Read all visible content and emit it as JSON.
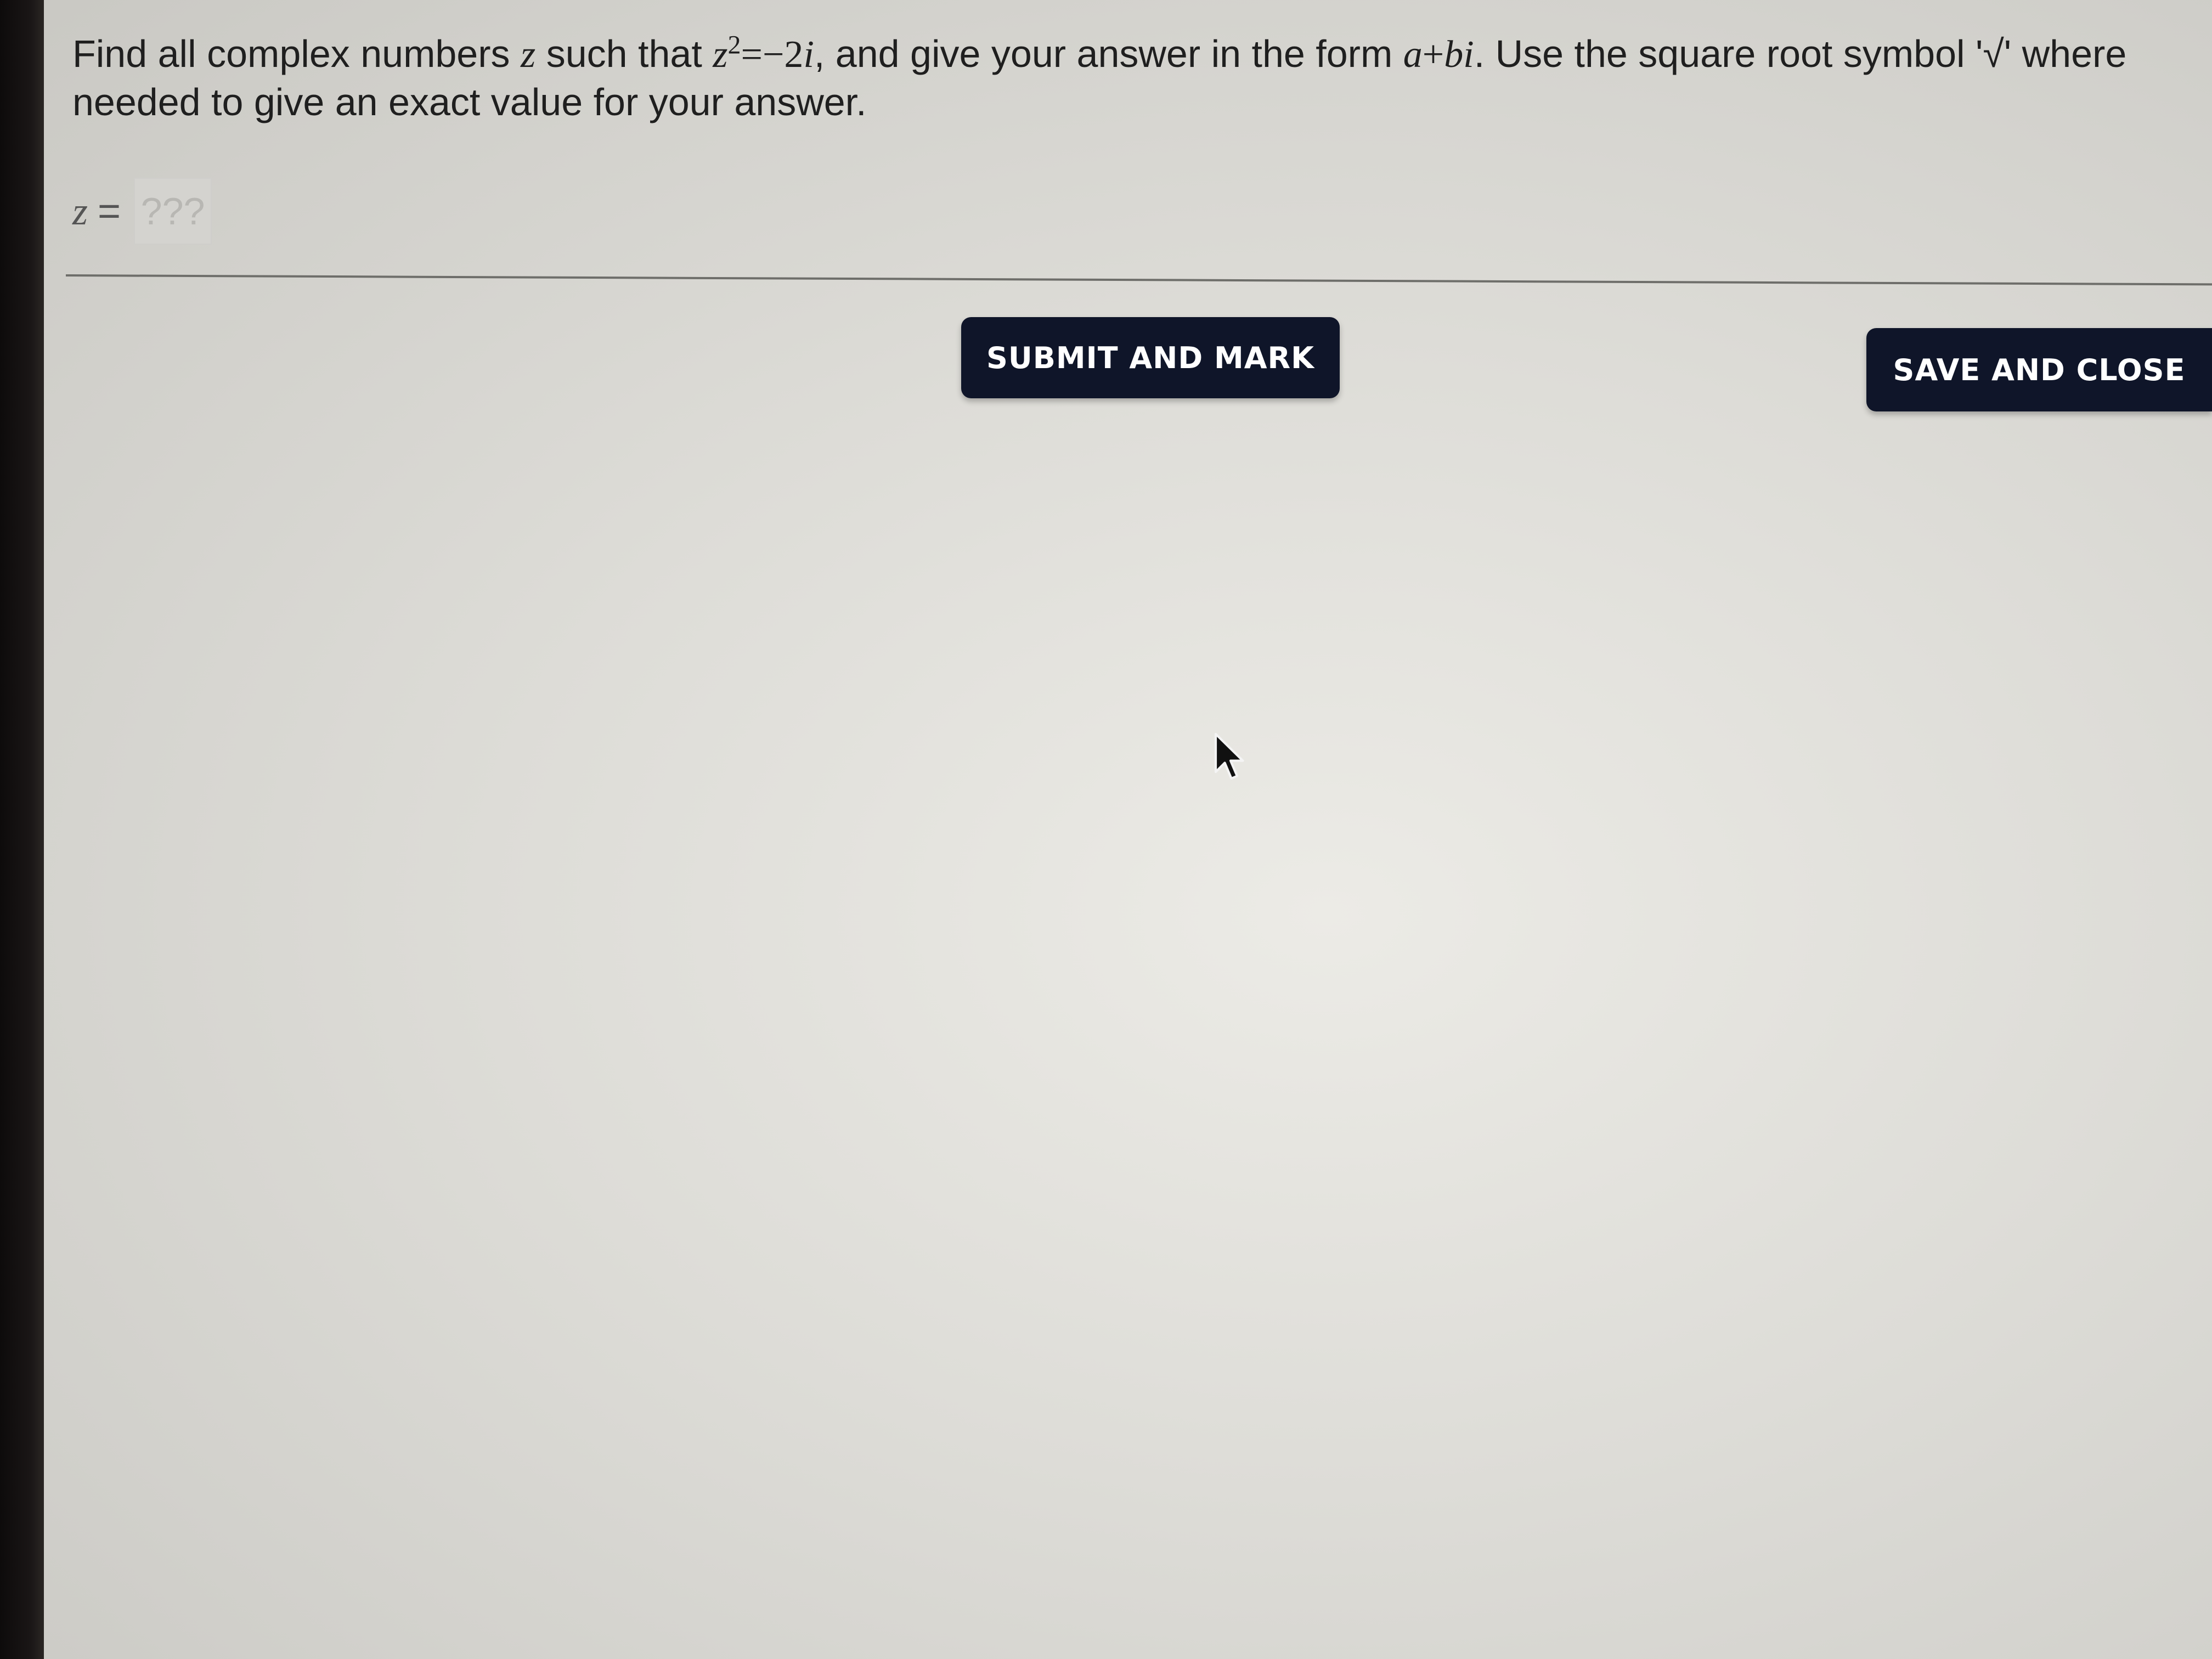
{
  "question": {
    "part1": "Find all complex numbers ",
    "var_z": "z",
    "part2": " such that ",
    "eq_z": "z",
    "eq_exp": "2",
    "eq_rhs": "=−2",
    "eq_i": "i",
    "part3": ", and give your answer in the form ",
    "form_a": "a",
    "form_plus": "+",
    "form_bi": "bi",
    "part4": ". Use the square root symbol '√' where needed to give an exact value for your answer."
  },
  "answer": {
    "label": "z",
    "equals": "=",
    "placeholder": "???"
  },
  "buttons": {
    "submit_label": "SUBMIT AND MARK",
    "save_label": "SAVE AND CLOSE"
  },
  "colors": {
    "button_bg": "#0f1529",
    "button_text": "#ffffff"
  },
  "icons": {
    "cursor": "arrow-cursor-icon"
  }
}
